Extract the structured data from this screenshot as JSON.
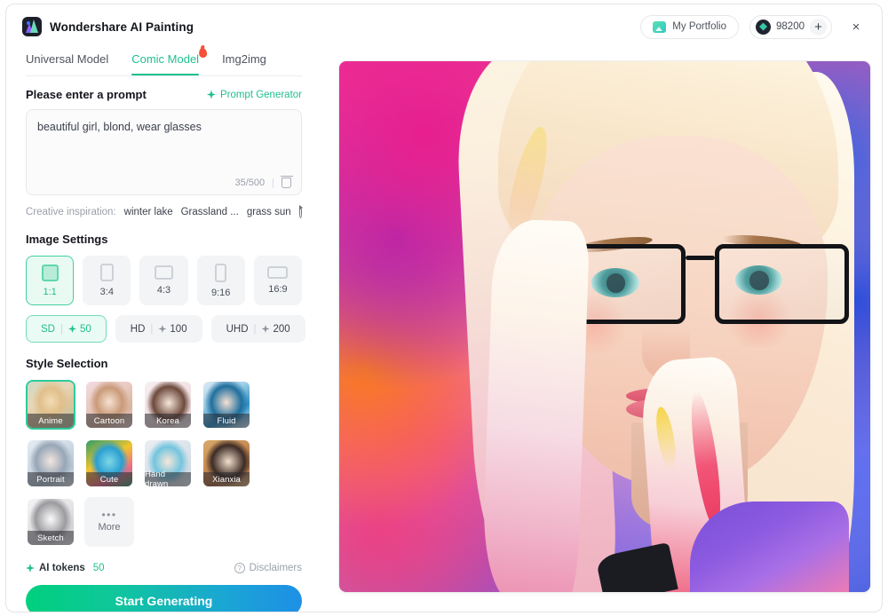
{
  "app": {
    "title": "Wondershare AI Painting",
    "logo_icon": "wondershare-logo-icon"
  },
  "titlebar": {
    "portfolio_label": "My Portfolio",
    "portfolio_icon": "image-icon",
    "token_icon": "token-coin-icon",
    "token_count": "98200",
    "token_add_label": "+",
    "close_label": "×"
  },
  "tabs": [
    {
      "label": "Universal Model",
      "active": false,
      "badge": ""
    },
    {
      "label": "Comic Model",
      "active": true,
      "badge": "flame-badge"
    },
    {
      "label": "Img2img",
      "active": false,
      "badge": ""
    }
  ],
  "prompt": {
    "section_title": "Please enter a prompt",
    "generator_label": "Prompt Generator",
    "generator_icon": "sparkle-icon",
    "value": "beautiful girl, blond, wear glasses",
    "placeholder": "Please enter a prompt",
    "counter": "35/500",
    "separator": "|",
    "clear_icon": "trash-icon"
  },
  "inspiration": {
    "label": "Creative inspiration:",
    "items": [
      "winter lake",
      "Grassland ...",
      "grass sun"
    ],
    "refresh_icon": "refresh-icon"
  },
  "image_settings": {
    "title": "Image Settings",
    "ratios": [
      {
        "label": "1:1",
        "selected": true
      },
      {
        "label": "3:4",
        "selected": false
      },
      {
        "label": "4:3",
        "selected": false
      },
      {
        "label": "9:16",
        "selected": false
      },
      {
        "label": "16:9",
        "selected": false
      }
    ],
    "qualities": [
      {
        "label": "SD",
        "cost": "50",
        "selected": true
      },
      {
        "label": "HD",
        "cost": "100",
        "selected": false
      },
      {
        "label": "UHD",
        "cost": "200",
        "selected": false
      }
    ]
  },
  "style_selection": {
    "title": "Style Selection",
    "styles": [
      {
        "label": "Anime",
        "selected": true
      },
      {
        "label": "Cartoon",
        "selected": false
      },
      {
        "label": "Korea",
        "selected": false
      },
      {
        "label": "Fluid",
        "selected": false
      },
      {
        "label": "Portrait",
        "selected": false
      },
      {
        "label": "Cute",
        "selected": false
      },
      {
        "label": "Hand drawn",
        "selected": false
      },
      {
        "label": "Xianxia",
        "selected": false
      },
      {
        "label": "Sketch",
        "selected": false
      }
    ],
    "more_label": "More",
    "more_icon": "ellipsis-icon"
  },
  "footer": {
    "tokens_label": "AI tokens",
    "tokens_value": "50",
    "tokens_icon": "sparkle-icon",
    "disclaimers_label": "Disclaimers",
    "disclaimers_icon": "question-icon",
    "generate_label": "Start Generating"
  },
  "preview": {
    "name": "generated-image-preview",
    "description": "AI generated watercolor portrait of a blond woman wearing black glasses"
  },
  "colors": {
    "accent_green": "#1fbf8f",
    "selected_bg": "#e9faf3",
    "panel_bg": "#f3f4f6",
    "text_primary": "#15171d",
    "text_muted": "#9aa0aa",
    "badge_red": "#f4503a"
  }
}
